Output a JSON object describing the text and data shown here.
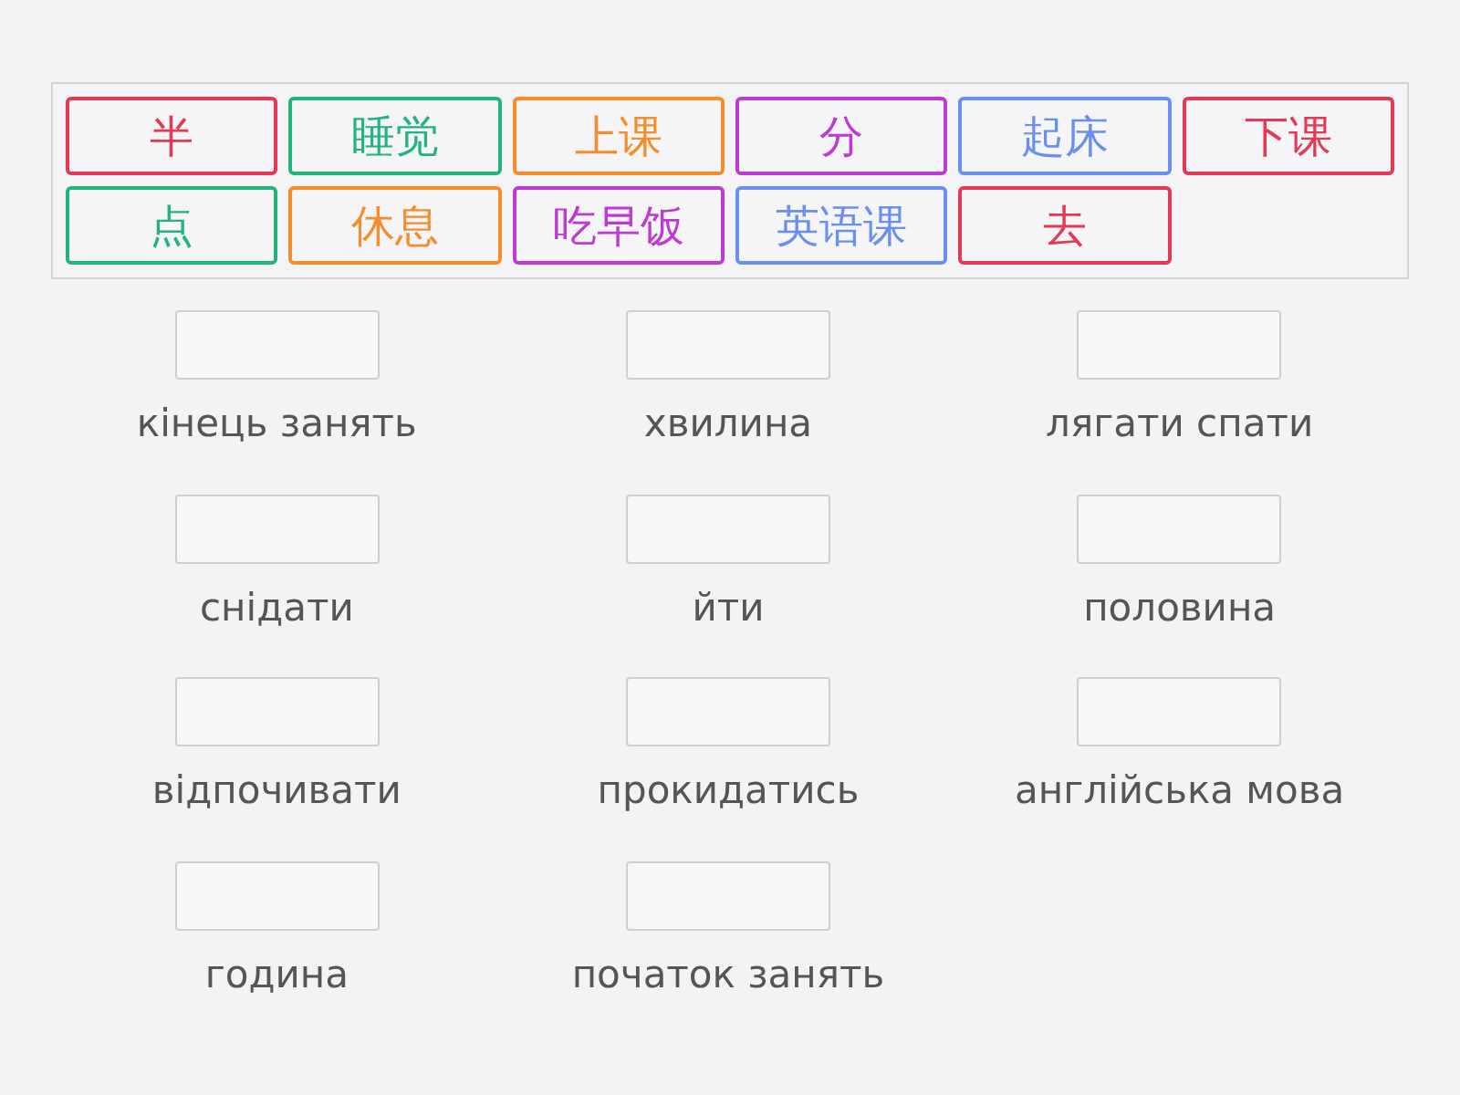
{
  "word_bank": {
    "tiles": [
      {
        "text": "半",
        "color": "#e23a55"
      },
      {
        "text": "睡觉",
        "color": "#22b47c"
      },
      {
        "text": "上课",
        "color": "#f58d2c"
      },
      {
        "text": "分",
        "color": "#bc3bd0"
      },
      {
        "text": "起床",
        "color": "#6b8ff0"
      },
      {
        "text": "下课",
        "color": "#e23a55"
      },
      {
        "text": "点",
        "color": "#22b47c"
      },
      {
        "text": "休息",
        "color": "#f58d2c"
      },
      {
        "text": "吃早饭",
        "color": "#bc3bd0"
      },
      {
        "text": "英语课",
        "color": "#6b8ff0"
      },
      {
        "text": "去",
        "color": "#e23a55"
      }
    ]
  },
  "targets": [
    {
      "label": "кінець занять"
    },
    {
      "label": "хвилина"
    },
    {
      "label": "лягати спати"
    },
    {
      "label": "снідати"
    },
    {
      "label": "йти"
    },
    {
      "label": "половина"
    },
    {
      "label": "відпочивати"
    },
    {
      "label": "прокидатись"
    },
    {
      "label": "англійська мова"
    },
    {
      "label": "година"
    },
    {
      "label": "початок занять"
    }
  ]
}
